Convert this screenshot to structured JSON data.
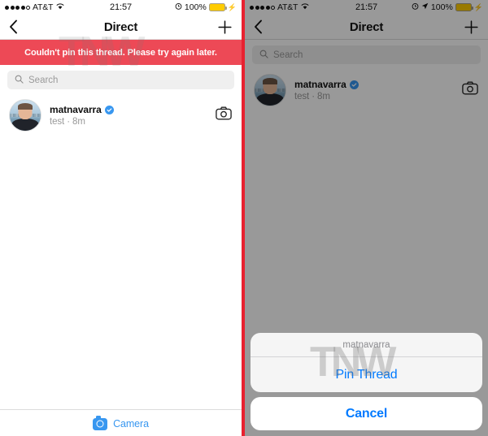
{
  "status_bar": {
    "carrier": "AT&T",
    "signal_dots_filled": 4,
    "signal_dots_total": 5,
    "wifi_icon": "wifi-icon",
    "time": "21:57",
    "alarm_icon": "alarm-clock-icon",
    "location_icon": "location-arrow-icon",
    "battery_percent": "100%",
    "battery_color": "#ffcc00",
    "charging_icon": "lightning-bolt-icon"
  },
  "nav": {
    "back_icon": "chevron-left-icon",
    "title": "Direct",
    "add_icon": "plus-icon"
  },
  "error_banner": {
    "message": "Couldn't pin this thread. Please try again later.",
    "background": "#ed4956",
    "text_color": "#ffffff"
  },
  "search": {
    "placeholder": "Search",
    "icon": "search-icon",
    "value": ""
  },
  "thread": {
    "avatar_icon": "user-avatar",
    "username": "matnavarra",
    "verified_icon": "verified-badge-icon",
    "preview": "test · 8m",
    "camera_icon": "camera-outline-icon"
  },
  "camera_bar": {
    "icon": "camera-icon",
    "label": "Camera",
    "color": "#3897f0"
  },
  "action_sheet": {
    "title": "matnavarra",
    "action_label": "Pin Thread",
    "cancel_label": "Cancel",
    "accent_color": "#007aff"
  },
  "watermark": {
    "text": "TNW"
  },
  "theme": {
    "divider_red": "#e8212f",
    "banner_red": "#ed4956",
    "instagram_blue": "#3897f0",
    "ios_blue": "#007aff"
  }
}
